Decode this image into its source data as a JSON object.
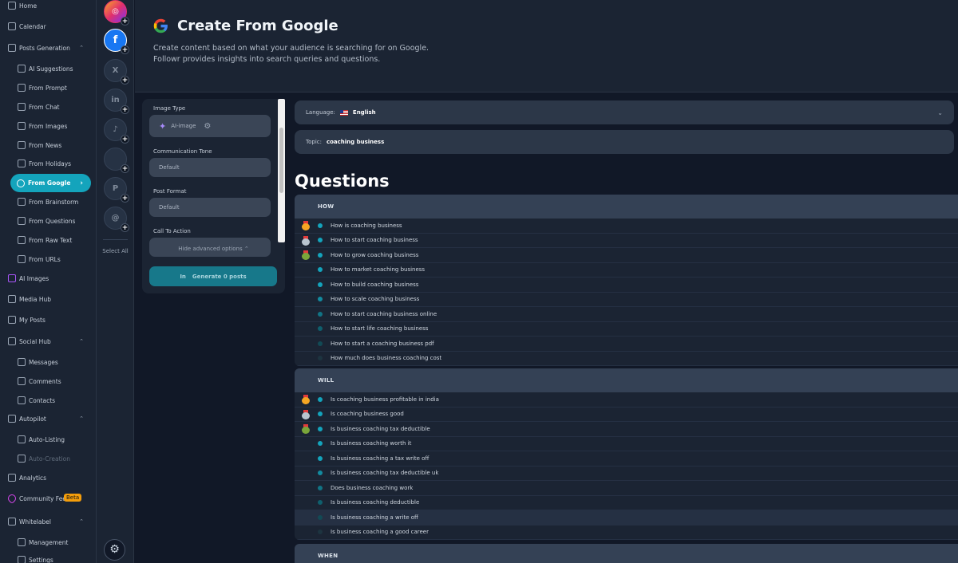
{
  "sidebar": {
    "items": [
      {
        "label": "Home",
        "level": "top",
        "icon": "home-icon"
      },
      {
        "label": "Calendar",
        "level": "top",
        "icon": "calendar-icon"
      },
      {
        "label": "Posts Generation",
        "level": "top",
        "icon": "posts-icon",
        "expanded": true
      },
      {
        "label": "AI Suggestions",
        "level": "sub",
        "icon": "sparkle-icon"
      },
      {
        "label": "From Prompt",
        "level": "sub",
        "icon": "prompt-icon"
      },
      {
        "label": "From Chat",
        "level": "sub",
        "icon": "chat-icon"
      },
      {
        "label": "From Images",
        "level": "sub",
        "icon": "image-icon"
      },
      {
        "label": "From News",
        "level": "sub",
        "icon": "news-icon"
      },
      {
        "label": "From Holidays",
        "level": "sub",
        "icon": "holiday-icon"
      },
      {
        "label": "From Google",
        "level": "sub",
        "icon": "google-icon",
        "active": true
      },
      {
        "label": "From Brainstorm",
        "level": "sub",
        "icon": "brainstorm-icon"
      },
      {
        "label": "From Questions",
        "level": "sub",
        "icon": "question-icon"
      },
      {
        "label": "From Raw Text",
        "level": "sub",
        "icon": "text-icon"
      },
      {
        "label": "From URLs",
        "level": "sub",
        "icon": "link-icon"
      },
      {
        "label": "AI Images",
        "level": "top",
        "icon": "ai-image-icon"
      },
      {
        "label": "Media Hub",
        "level": "top",
        "icon": "media-icon"
      },
      {
        "label": "My Posts",
        "level": "top",
        "icon": "my-posts-icon"
      },
      {
        "label": "Social Hub",
        "level": "top",
        "icon": "social-icon",
        "expanded": true
      },
      {
        "label": "Messages",
        "level": "sub",
        "icon": "message-icon"
      },
      {
        "label": "Comments",
        "level": "sub",
        "icon": "comment-icon"
      },
      {
        "label": "Contacts",
        "level": "sub",
        "icon": "contacts-icon"
      },
      {
        "label": "Autopilot",
        "level": "top",
        "icon": "autopilot-icon",
        "expanded": true
      },
      {
        "label": "Auto-Listing",
        "level": "sub",
        "icon": "listing-icon"
      },
      {
        "label": "Auto-Creation",
        "level": "sub",
        "icon": "creation-icon",
        "disabled": true
      },
      {
        "label": "Analytics",
        "level": "top",
        "icon": "analytics-icon"
      },
      {
        "label": "Community Feed",
        "level": "top",
        "icon": "heart-icon",
        "badge": "Beta"
      },
      {
        "label": "Whitelabel",
        "level": "top",
        "icon": "whitelabel-icon",
        "expanded": true
      },
      {
        "label": "Management",
        "level": "sub",
        "icon": "management-icon"
      },
      {
        "label": "Settings",
        "level": "sub",
        "icon": "settings-icon"
      }
    ]
  },
  "rail": {
    "accounts": [
      {
        "network": "instagram",
        "glyph": "◎"
      },
      {
        "network": "facebook",
        "glyph": "f"
      },
      {
        "network": "x",
        "glyph": "X"
      },
      {
        "network": "linkedin",
        "glyph": "in"
      },
      {
        "network": "tiktok",
        "glyph": "♪"
      },
      {
        "network": "youtube",
        "glyph": ""
      },
      {
        "network": "pinterest",
        "glyph": "P"
      },
      {
        "network": "threads",
        "glyph": "@"
      }
    ],
    "plus": "+",
    "select_all": "Select All"
  },
  "header": {
    "title": "Create From Google",
    "description": "Create content based on what your audience is searching for on Google. Followr provides insights into search queries and questions."
  },
  "panel": {
    "image_type_label": "Image Type",
    "image_type_value": "AI-image",
    "tone_label": "Communication Tone",
    "tone_value": "Default",
    "format_label": "Post Format",
    "format_value": "Default",
    "cta_label": "Call To Action",
    "advanced_toggle": "Hide advanced options",
    "generate_label": "Generate 0 posts",
    "generate_icon": "In"
  },
  "language": {
    "label": "Language:",
    "value": "English"
  },
  "topic": {
    "label": "Topic:",
    "value": "coaching business"
  },
  "questions_title": "Questions",
  "colors": {
    "accent": "#14a4bc",
    "gold": "#f5a623",
    "silver": "#b8c4cf",
    "bronze": "#7aa63a"
  },
  "groups": [
    {
      "heading": "HOW",
      "rows": [
        {
          "text": "How is coaching business",
          "medal": "gold",
          "dot": "#14a4bc"
        },
        {
          "text": "How to start coaching business",
          "medal": "silver",
          "dot": "#14a4bc"
        },
        {
          "text": "How to grow coaching business",
          "medal": "bronze",
          "dot": "#14a4bc"
        },
        {
          "text": "How to market coaching business",
          "dot": "#14a4bc"
        },
        {
          "text": "How to build coaching business",
          "dot": "#14a4bc"
        },
        {
          "text": "How to scale coaching business",
          "dot": "#138ba0"
        },
        {
          "text": "How to start coaching business online",
          "dot": "#117485"
        },
        {
          "text": "How to start life coaching business",
          "dot": "#0f5f6d"
        },
        {
          "text": "How to start a coaching business pdf",
          "dot": "#124a55"
        },
        {
          "text": "How much does business coaching cost",
          "dot": "#1d3440"
        }
      ]
    },
    {
      "heading": "WILL",
      "rows": [
        {
          "text": "Is coaching business profitable in india",
          "medal": "gold",
          "dot": "#14a4bc"
        },
        {
          "text": "Is coaching business good",
          "medal": "silver",
          "dot": "#14a4bc"
        },
        {
          "text": "Is business coaching tax deductible",
          "medal": "bronze",
          "dot": "#14a4bc"
        },
        {
          "text": "Is business coaching worth it",
          "dot": "#14a4bc"
        },
        {
          "text": "Is business coaching a tax write off",
          "dot": "#14a4bc"
        },
        {
          "text": "Is business coaching tax deductible uk",
          "dot": "#138ba0"
        },
        {
          "text": "Does business coaching work",
          "dot": "#117485"
        },
        {
          "text": "Is business coaching deductible",
          "dot": "#0f5f6d"
        },
        {
          "text": "Is business coaching a write off",
          "dot": "#124a55",
          "highlight": true
        },
        {
          "text": "Is business coaching a good career",
          "dot": "#1d3440"
        }
      ]
    },
    {
      "heading": "WHEN",
      "rows": []
    }
  ]
}
